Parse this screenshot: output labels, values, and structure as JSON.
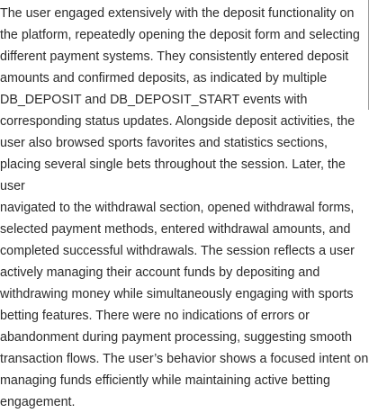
{
  "summary": {
    "text": "The user engaged extensively with the deposit functionality on\nthe platform, repeatedly opening the deposit form and selecting\ndifferent payment systems. They consistently entered deposit\namounts and confirmed deposits, as indicated by multiple\nDB_DEPOSIT and DB_DEPOSIT_START events with\ncorresponding status updates. Alongside deposit activities, the\nuser also browsed sports favorites and statistics sections,\nplacing several single bets throughout the session. Later, the user\nnavigated to the withdrawal section, opened withdrawal forms,\nselected payment methods, entered withdrawal amounts, and\ncompleted successful withdrawals. The session reflects a user\nactively managing their account funds by depositing and\nwithdrawing money while simultaneously engaging with sports\nbetting features. There were no indications of errors or\nabandonment during payment processing, suggesting smooth\ntransaction flows. The user’s behavior shows a focused intent on\nmanaging funds efficiently while maintaining active betting\nengagement."
  },
  "colors": {
    "text": "#2b2b2b",
    "background": "#ffffff",
    "scrollbar": "#9a9a9a"
  }
}
